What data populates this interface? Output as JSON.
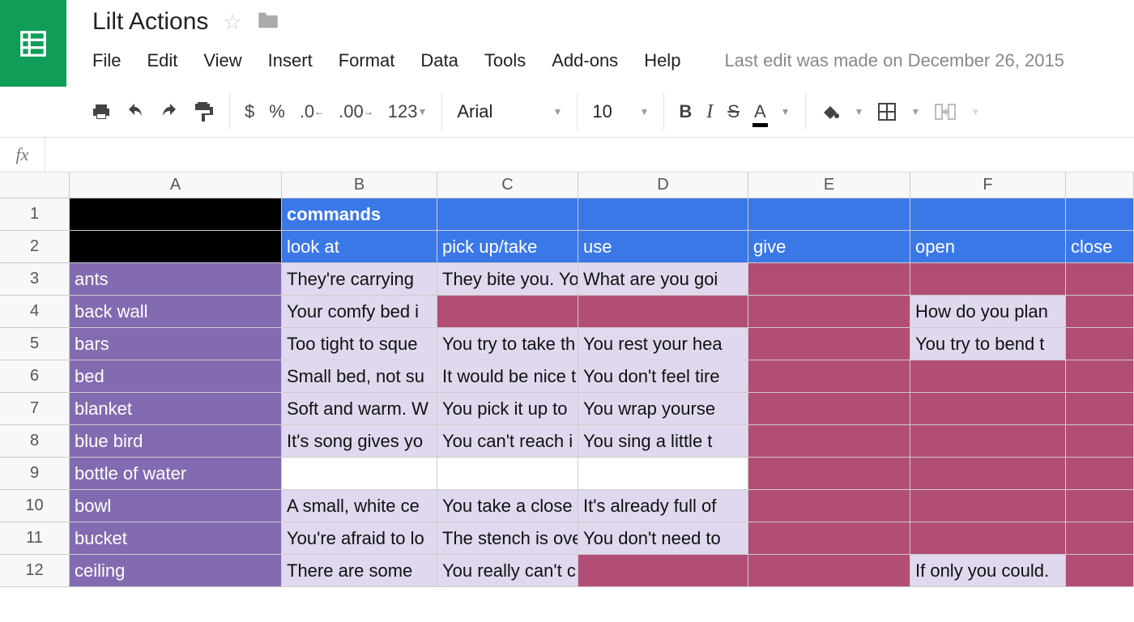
{
  "doc_title": "Lilt Actions",
  "last_edit": "Last edit was made on December 26, 2015",
  "menu": [
    "File",
    "Edit",
    "View",
    "Insert",
    "Format",
    "Data",
    "Tools",
    "Add-ons",
    "Help"
  ],
  "toolbar": {
    "currency": "$",
    "percent": "%",
    "dec_dec": ".0",
    "inc_dec": ".00",
    "num_format": "123",
    "font": "Arial",
    "size": "10",
    "bold": "B",
    "italic": "I",
    "strike": "S",
    "textcolor": "A"
  },
  "fx_label": "fx",
  "columns": [
    "A",
    "B",
    "C",
    "D",
    "E",
    "F",
    ""
  ],
  "row_nums": [
    "1",
    "2",
    "3",
    "4",
    "5",
    "6",
    "7",
    "8",
    "9",
    "10",
    "11",
    "12"
  ],
  "header1": {
    "B": "commands"
  },
  "header2": {
    "B": "look at",
    "C": "pick up/take",
    "D": "use",
    "E": "give",
    "F": "open",
    "G": "close"
  },
  "rows": [
    {
      "A": "ants",
      "B": "They're carrying",
      "C": "They bite you. Yo",
      "D": "What are you goi",
      "E": "",
      "F": "",
      "G": "",
      "fill": {
        "A": "purple",
        "B": "lavender",
        "C": "lavender",
        "D": "lavender",
        "E": "maroon",
        "F": "maroon",
        "G": "maroon"
      }
    },
    {
      "A": "back wall",
      "B": "Your comfy bed i",
      "C": "",
      "D": "",
      "E": "",
      "F": "How do you plan",
      "G": "",
      "fill": {
        "A": "purple",
        "B": "lavender",
        "C": "maroon",
        "D": "maroon",
        "E": "maroon",
        "F": "lavender",
        "G": "maroon"
      }
    },
    {
      "A": "bars",
      "B": "Too tight to sque",
      "C": "You try to take th",
      "D": "You rest your hea",
      "E": "",
      "F": "You try to bend t",
      "G": "",
      "fill": {
        "A": "purple",
        "B": "lavender",
        "C": "lavender",
        "D": "lavender",
        "E": "maroon",
        "F": "lavender",
        "G": "maroon"
      }
    },
    {
      "A": "bed",
      "B": "Small bed, not su",
      "C": "It would be nice t",
      "D": "You don't feel tire",
      "E": "",
      "F": "",
      "G": "",
      "fill": {
        "A": "purple",
        "B": "lavender",
        "C": "lavender",
        "D": "lavender",
        "E": "maroon",
        "F": "maroon",
        "G": "maroon"
      }
    },
    {
      "A": "blanket",
      "B": "Soft and warm. W",
      "C": "You pick it up to",
      "D": "You wrap yourse",
      "E": "",
      "F": "",
      "G": "",
      "fill": {
        "A": "purple",
        "B": "lavender",
        "C": "lavender",
        "D": "lavender",
        "E": "maroon",
        "F": "maroon",
        "G": "maroon"
      }
    },
    {
      "A": "blue bird",
      "B": "It's song gives yo",
      "C": "You can't reach i",
      "D": "You sing a little t",
      "E": "",
      "F": "",
      "G": "",
      "fill": {
        "A": "purple",
        "B": "lavender",
        "C": "lavender",
        "D": "lavender",
        "E": "maroon",
        "F": "maroon",
        "G": "maroon"
      }
    },
    {
      "A": "bottle of water",
      "B": "",
      "C": "",
      "D": "",
      "E": "",
      "F": "",
      "G": "",
      "fill": {
        "A": "purple",
        "B": "white",
        "C": "white",
        "D": "white",
        "E": "maroon",
        "F": "maroon",
        "G": "maroon"
      }
    },
    {
      "A": "bowl",
      "B": "A small, white ce",
      "C": "You take a close",
      "D": "It's already full of",
      "E": "",
      "F": "",
      "G": "",
      "fill": {
        "A": "purple",
        "B": "lavender",
        "C": "lavender",
        "D": "lavender",
        "E": "maroon",
        "F": "maroon",
        "G": "maroon"
      }
    },
    {
      "A": "bucket",
      "B": "You're afraid to lo",
      "C": "The stench is ove",
      "D": "You don't need to",
      "E": "",
      "F": "",
      "G": "",
      "fill": {
        "A": "purple",
        "B": "lavender",
        "C": "lavender",
        "D": "lavender",
        "E": "maroon",
        "F": "maroon",
        "G": "maroon"
      }
    },
    {
      "A": "ceiling",
      "B": "There are some",
      "C": "You really can't c",
      "D": "",
      "E": "",
      "F": "If only you could.",
      "G": "",
      "fill": {
        "A": "purple",
        "B": "lavender",
        "C": "lavender",
        "D": "maroon",
        "E": "maroon",
        "F": "lavender",
        "G": "maroon"
      }
    }
  ]
}
